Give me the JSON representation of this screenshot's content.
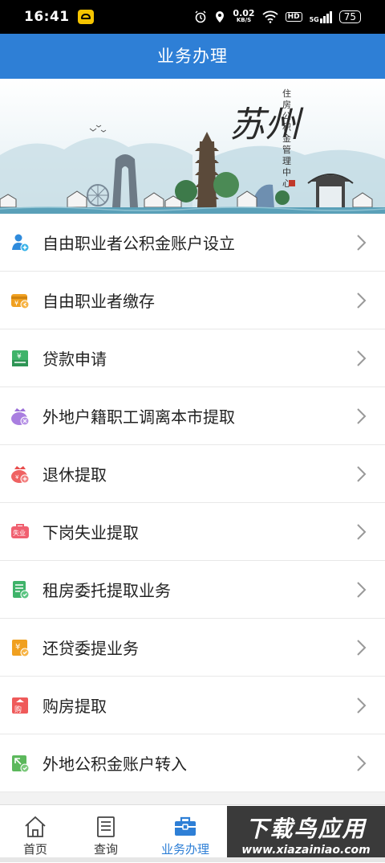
{
  "status_bar": {
    "time": "16:41",
    "net_speed": "0.02",
    "net_unit": "KB/S",
    "hd": "HD",
    "signal": "5G",
    "battery": "75"
  },
  "header": {
    "title": "业务办理"
  },
  "banner": {
    "calligraphy": "苏州",
    "vertical_text": [
      "住",
      "房",
      "公",
      "积",
      "金",
      "管",
      "理",
      "中",
      "心"
    ]
  },
  "menu": {
    "items": [
      {
        "label": "自由职业者公积金账户设立",
        "icon": "person-add-icon",
        "color": "#2f8bdc"
      },
      {
        "label": "自由职业者缴存",
        "icon": "deposit-icon",
        "color": "#f0a020"
      },
      {
        "label": "贷款申请",
        "icon": "loan-icon",
        "color": "#3fb36a"
      },
      {
        "label": "外地户籍职工调离本市提取",
        "icon": "purse-icon",
        "color": "#9b6fd8"
      },
      {
        "label": "退休提取",
        "icon": "purse-icon",
        "color": "#ef5a5a"
      },
      {
        "label": "下岗失业提取",
        "icon": "unemployment-icon",
        "color": "#f06070",
        "icon_text": "失业"
      },
      {
        "label": "租房委托提取业务",
        "icon": "document-icon",
        "color": "#3fb36a"
      },
      {
        "label": "还贷委提业务",
        "icon": "repay-icon",
        "color": "#f0a020"
      },
      {
        "label": "购房提取",
        "icon": "purchase-icon",
        "color": "#ef5a5a",
        "icon_text": "购"
      },
      {
        "label": "外地公积金账户转入",
        "icon": "transfer-icon",
        "color": "#3fb36a"
      }
    ]
  },
  "tabbar": {
    "tabs": [
      {
        "label": "首页",
        "icon": "home-icon"
      },
      {
        "label": "查询",
        "icon": "list-icon"
      },
      {
        "label": "业务办理",
        "icon": "briefcase-icon",
        "active": true
      }
    ]
  },
  "watermark": {
    "main": "下载鸟应用",
    "url": "www.xiazainiao.com"
  }
}
